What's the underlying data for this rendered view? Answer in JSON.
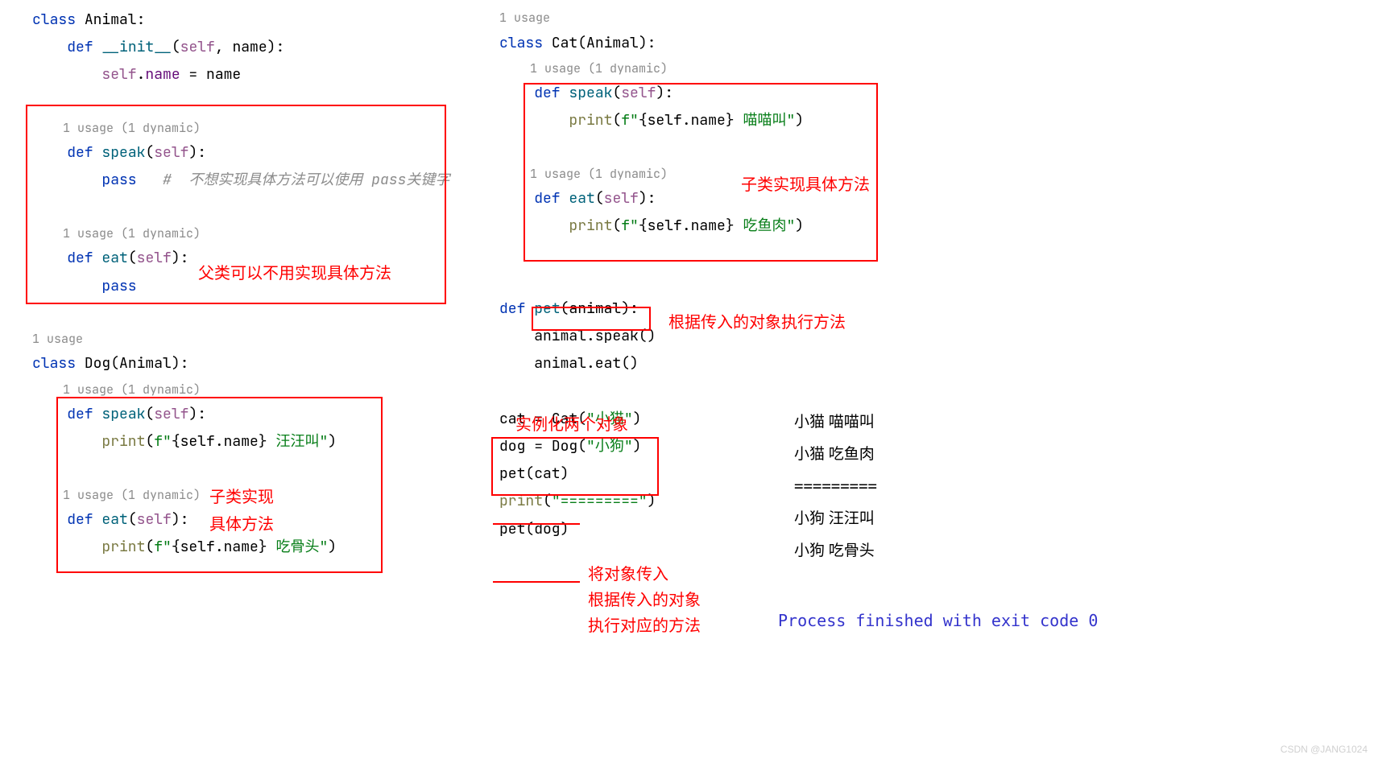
{
  "left": {
    "class_animal": "class",
    "animal_name": "Animal",
    "def": "def",
    "init": "__init__",
    "self": "self",
    "name_param": "name",
    "assign_left": "self",
    "assign_attr": "name",
    "assign_right": "name",
    "u1": "1 usage (1 dynamic)",
    "speak": "speak",
    "pass": "pass",
    "comment_pass": "#  不想实现具体方法可以使用 pass关键字",
    "u2": "1 usage (1 dynamic)",
    "eat": "eat",
    "u_dog": "1 usage",
    "dog_name": "Dog",
    "base_dog": "Animal",
    "u3": "1 usage (1 dynamic)",
    "print": "print",
    "fstr_open": "f\"",
    "brace_self_name": "{self.name}",
    "dog_bark": " 汪汪叫\"",
    "u4": "1 usage (1 dynamic)",
    "dog_eat_str": " 吃骨头\""
  },
  "right": {
    "u_cat": "1 usage",
    "class": "class",
    "cat_name": "Cat",
    "base_cat": "Animal",
    "u5": "1 usage (1 dynamic)",
    "def": "def",
    "speak": "speak",
    "self": "self",
    "print": "print",
    "fstr_open": "f\"",
    "brace_self_name": "{self.name}",
    "cat_meow": " 喵喵叫\"",
    "u6": "1 usage (1 dynamic)",
    "eat": "eat",
    "cat_eat_str": " 吃鱼肉\"",
    "pet": "pet",
    "animal_param": "animal",
    "call_speak": "animal.speak()",
    "call_eat": "animal.eat()",
    "cat_var": "cat = ",
    "cat_call": "Cat",
    "cat_arg": "\"小猫\"",
    "dog_var": "dog = ",
    "dog_call": "Dog",
    "dog_arg": "\"小狗\"",
    "pet_cat": "pet(cat)",
    "print_sep": "print",
    "sep_str": "\"=========\"",
    "pet_dog": "pet(dog)"
  },
  "annotations": {
    "parent_no_impl": "父类可以不用实现具体方法",
    "child_impl1": "子类实现",
    "child_impl1b": "具体方法",
    "child_impl2": "子类实现具体方法",
    "by_obj": "根据传入的对象执行方法",
    "inst_two": "实例化两个对象",
    "pass_obj1": "将对象传入",
    "pass_obj2": "根据传入的对象",
    "pass_obj3": "执行对应的方法"
  },
  "output": {
    "l1": "小猫 喵喵叫",
    "l2": "小猫 吃鱼肉",
    "l3": "=========",
    "l4": "小狗 汪汪叫",
    "l5": "小狗 吃骨头"
  },
  "exit": "Process finished with exit code 0",
  "watermark": "CSDN @JANG1024"
}
